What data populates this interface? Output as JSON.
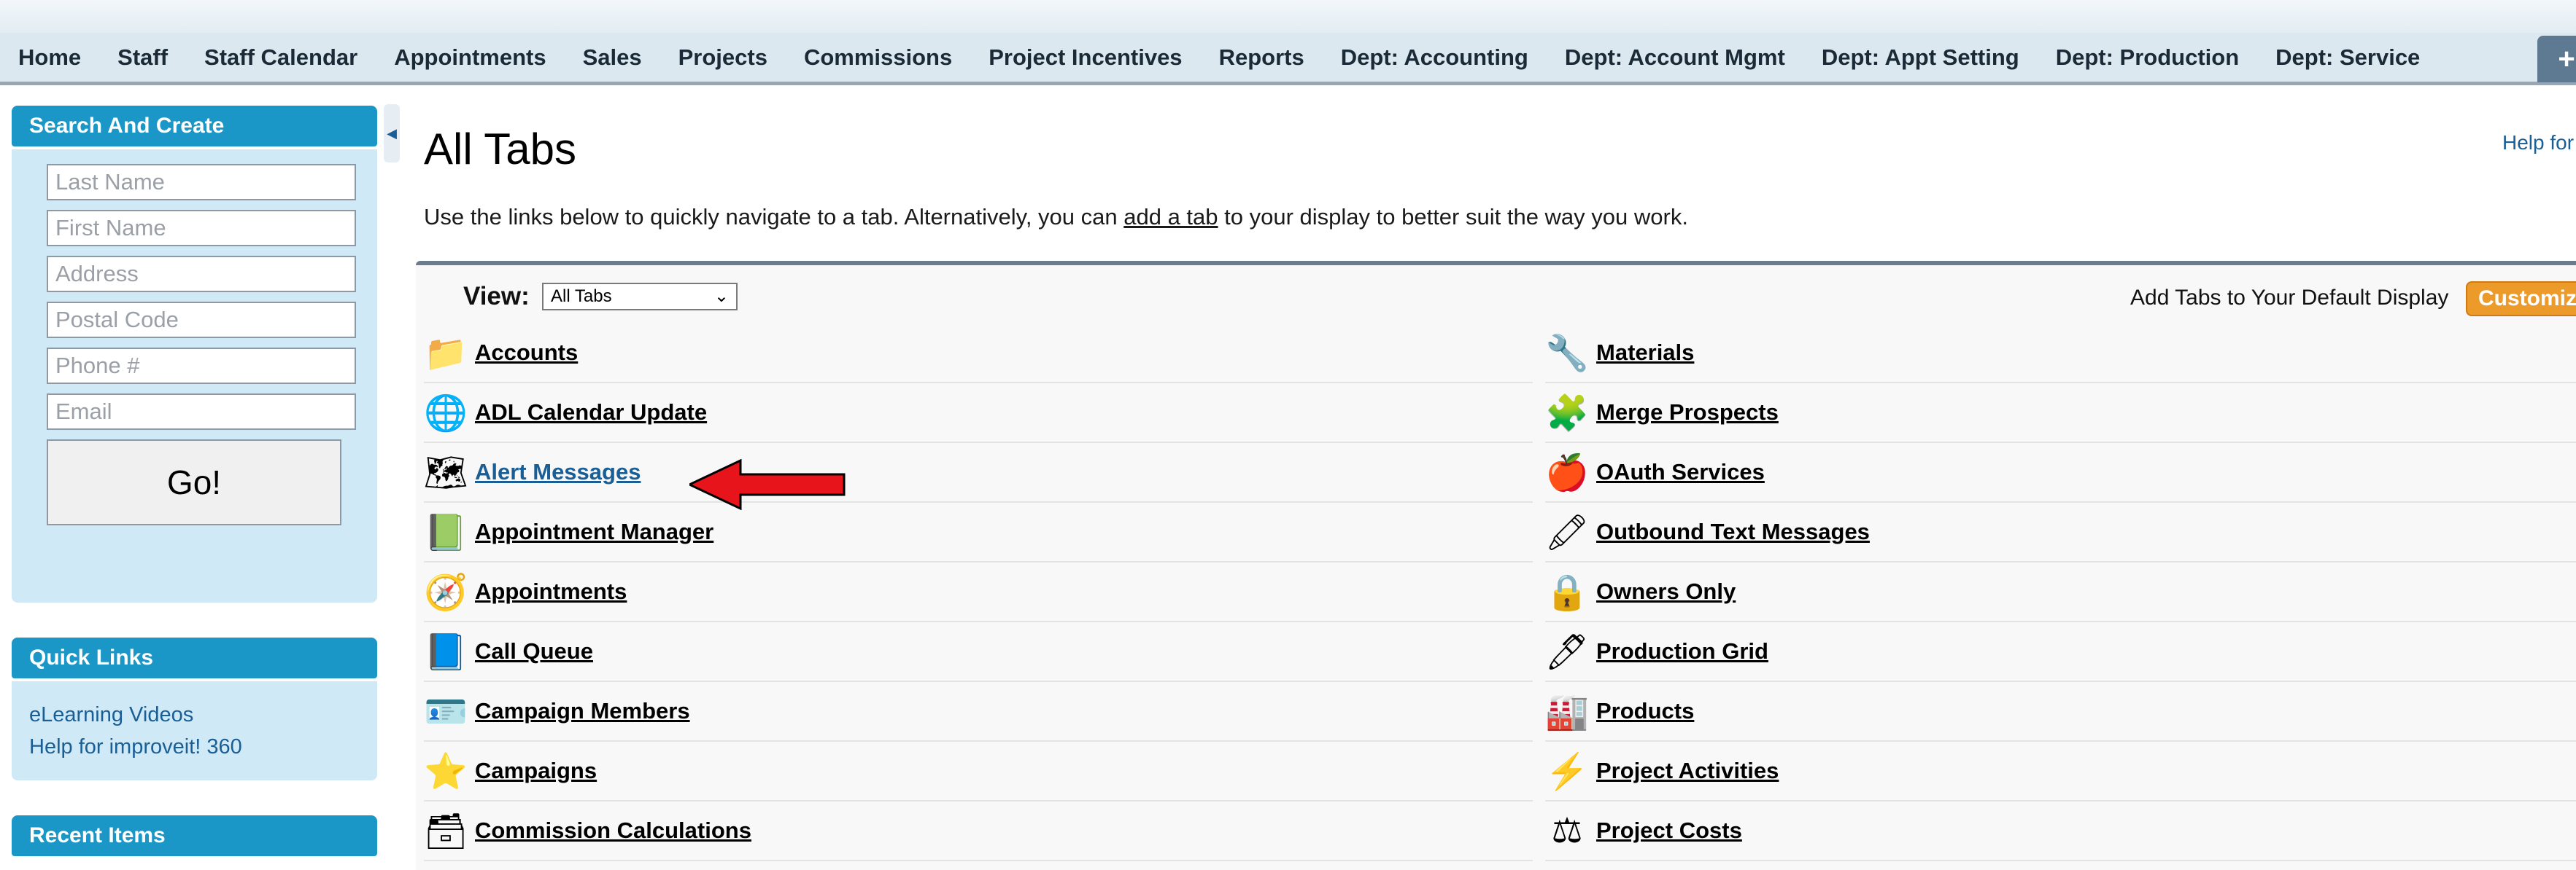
{
  "nav": {
    "tabs": [
      "Home",
      "Staff",
      "Staff Calendar",
      "Appointments",
      "Sales",
      "Projects",
      "Commissions",
      "Project Incentives",
      "Reports",
      "Dept: Accounting",
      "Dept: Account Mgmt",
      "Dept: Appt Setting",
      "Dept: Production",
      "Dept: Service"
    ],
    "plus": "+"
  },
  "sidebar": {
    "search_title": "Search And Create",
    "placeholders": {
      "last_name": "Last Name",
      "first_name": "First Name",
      "address": "Address",
      "postal_code": "Postal Code",
      "phone": "Phone #",
      "email": "Email"
    },
    "go_label": "Go!",
    "quick_links_title": "Quick Links",
    "quick_links": [
      "eLearning Videos",
      "Help for improveit! 360"
    ],
    "recent_title": "Recent Items"
  },
  "main": {
    "title": "All Tabs",
    "help_link": "Help for",
    "intro_before": "Use the links below to quickly navigate to a tab. Alternatively, you can ",
    "intro_link": "add a tab",
    "intro_after": " to your display to better suit the way you work.",
    "view_label": "View:",
    "view_value": "All Tabs",
    "add_tabs_label": "Add Tabs to Your Default Display",
    "customize_label": "Customize",
    "left_tabs": [
      {
        "label": "Accounts",
        "icon": "folder-icon",
        "glyph": "📁"
      },
      {
        "label": "ADL Calendar Update",
        "icon": "globe-icon",
        "glyph": "🌐"
      },
      {
        "label": "Alert Messages",
        "icon": "map-icon",
        "glyph": "🗺"
      },
      {
        "label": "Appointment Manager",
        "icon": "notebook-icon",
        "glyph": "📗"
      },
      {
        "label": "Appointments",
        "icon": "compass-icon",
        "glyph": "🧭"
      },
      {
        "label": "Call Queue",
        "icon": "book-icon",
        "glyph": "📘"
      },
      {
        "label": "Campaign Members",
        "icon": "card-icon",
        "glyph": "🪪"
      },
      {
        "label": "Campaigns",
        "icon": "star-icon",
        "glyph": "⭐"
      },
      {
        "label": "Commission Calculations",
        "icon": "tray-icon",
        "glyph": "🗃"
      }
    ],
    "right_tabs": [
      {
        "label": "Materials",
        "icon": "tools-icon",
        "glyph": "🔧"
      },
      {
        "label": "Merge Prospects",
        "icon": "puzzle-icon",
        "glyph": "🧩"
      },
      {
        "label": "OAuth Services",
        "icon": "apple-icon",
        "glyph": "🍎"
      },
      {
        "label": "Outbound Text Messages",
        "icon": "crayons-icon",
        "glyph": "🖍"
      },
      {
        "label": "Owners Only",
        "icon": "lock-icon",
        "glyph": "🔒"
      },
      {
        "label": "Production Grid",
        "icon": "pen-icon",
        "glyph": "🖊"
      },
      {
        "label": "Products",
        "icon": "factory-icon",
        "glyph": "🏭"
      },
      {
        "label": "Project Activities",
        "icon": "lightning-icon",
        "glyph": "⚡"
      },
      {
        "label": "Project Costs",
        "icon": "scale-icon",
        "glyph": "⚖"
      }
    ]
  },
  "colors": {
    "accent": "#1a97c6",
    "panel": "#cfeaf6",
    "customize": "#ec9a2a",
    "arrow": "#e8141c"
  }
}
